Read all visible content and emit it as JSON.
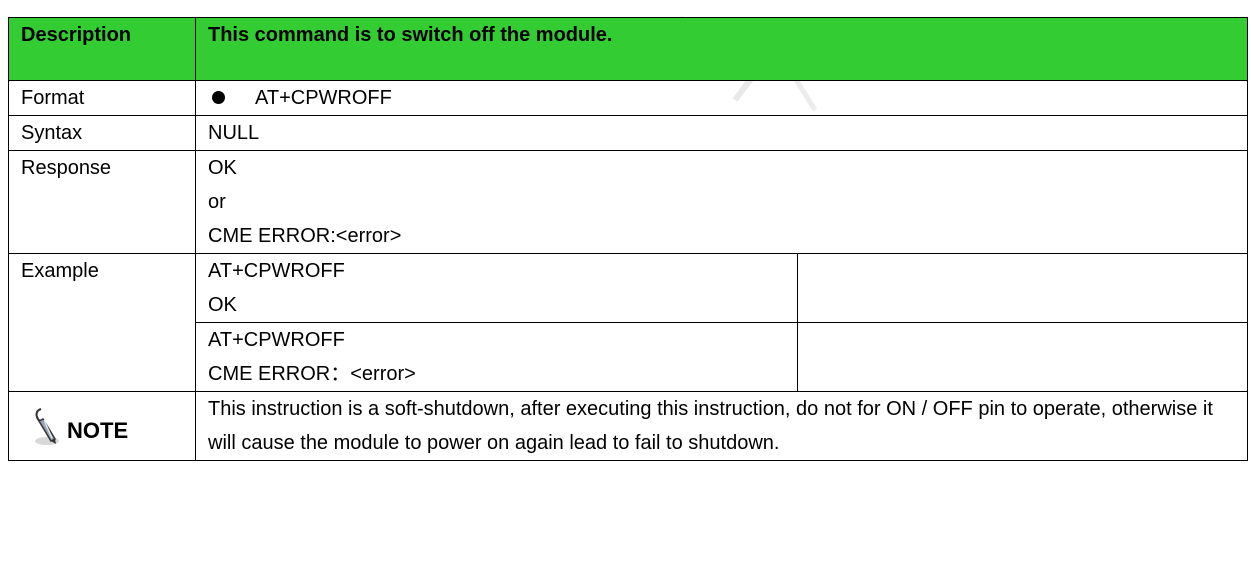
{
  "header": {
    "label": "Description",
    "text": "This command is to switch off the module."
  },
  "format": {
    "label": "Format",
    "value": "AT+CPWROFF"
  },
  "syntax": {
    "label": "Syntax",
    "value": "NULL"
  },
  "response": {
    "label": "Response",
    "lines": [
      "OK",
      "or",
      "CME ERROR:<error>"
    ]
  },
  "example": {
    "label": "Example",
    "blocks": [
      {
        "lines": [
          "AT+CPWROFF",
          "OK"
        ],
        "note": ""
      },
      {
        "lines": [
          "AT+CPWROFF",
          "CME ERROR：<error>"
        ],
        "note": ""
      }
    ]
  },
  "note": {
    "label": "NOTE",
    "icon": "note-pen-icon",
    "text": "This instruction is a soft-shutdown, after executing this instruction, do not for ON / OFF pin to operate, otherwise it will cause the module to power on again lead to fail to shutdown."
  },
  "colors": {
    "header_bg": "#33cc33",
    "border": "#000000"
  }
}
